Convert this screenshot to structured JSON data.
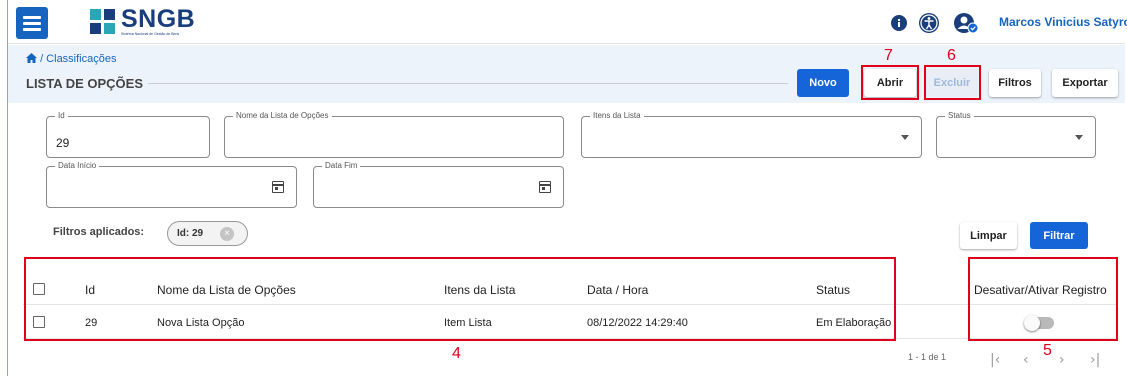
{
  "app": {
    "logo_text": "SNGB",
    "logo_subtitle": "Sistema Nacional de Gestão de Bens",
    "user_name": "Marcos Vinicius Satyro C..."
  },
  "header": {
    "breadcrumb": "/ Classificações",
    "title": "LISTA DE OPÇÕES",
    "buttons": {
      "novo": "Novo",
      "abrir": "Abrir",
      "excluir": "Excluir",
      "filtros": "Filtros",
      "exportar": "Exportar"
    }
  },
  "filters": {
    "id": {
      "label": "Id",
      "value": "29"
    },
    "nome": {
      "label": "Nome da Lista de Opções",
      "value": ""
    },
    "itens": {
      "label": "Itens da Lista",
      "value": ""
    },
    "status": {
      "label": "Status",
      "value": ""
    },
    "data_inicio": {
      "label": "Data Início",
      "value": ""
    },
    "data_fim": {
      "label": "Data Fim",
      "value": ""
    },
    "applied_label": "Filtros aplicados:",
    "applied_chip": "Id: 29",
    "limpar": "Limpar",
    "filtrar": "Filtrar"
  },
  "table": {
    "headers": [
      "Id",
      "Nome da Lista de Opções",
      "Itens da Lista",
      "Data / Hora",
      "Status",
      "Desativar/Ativar Registro"
    ],
    "rows": [
      [
        "29",
        "Nova Lista Opção",
        "Item Lista",
        "08/12/2022 14:29:40",
        "Em Elaboração"
      ]
    ],
    "toggle_active": false
  },
  "pagination": {
    "range": "1 - 1 de 1"
  },
  "annotations": {
    "a4": "4",
    "a5": "5",
    "a6": "6",
    "a7": "7"
  },
  "colors": {
    "primary": "#1565d8",
    "annotation": "#e0001b",
    "header_bg": "#edf3fb"
  }
}
